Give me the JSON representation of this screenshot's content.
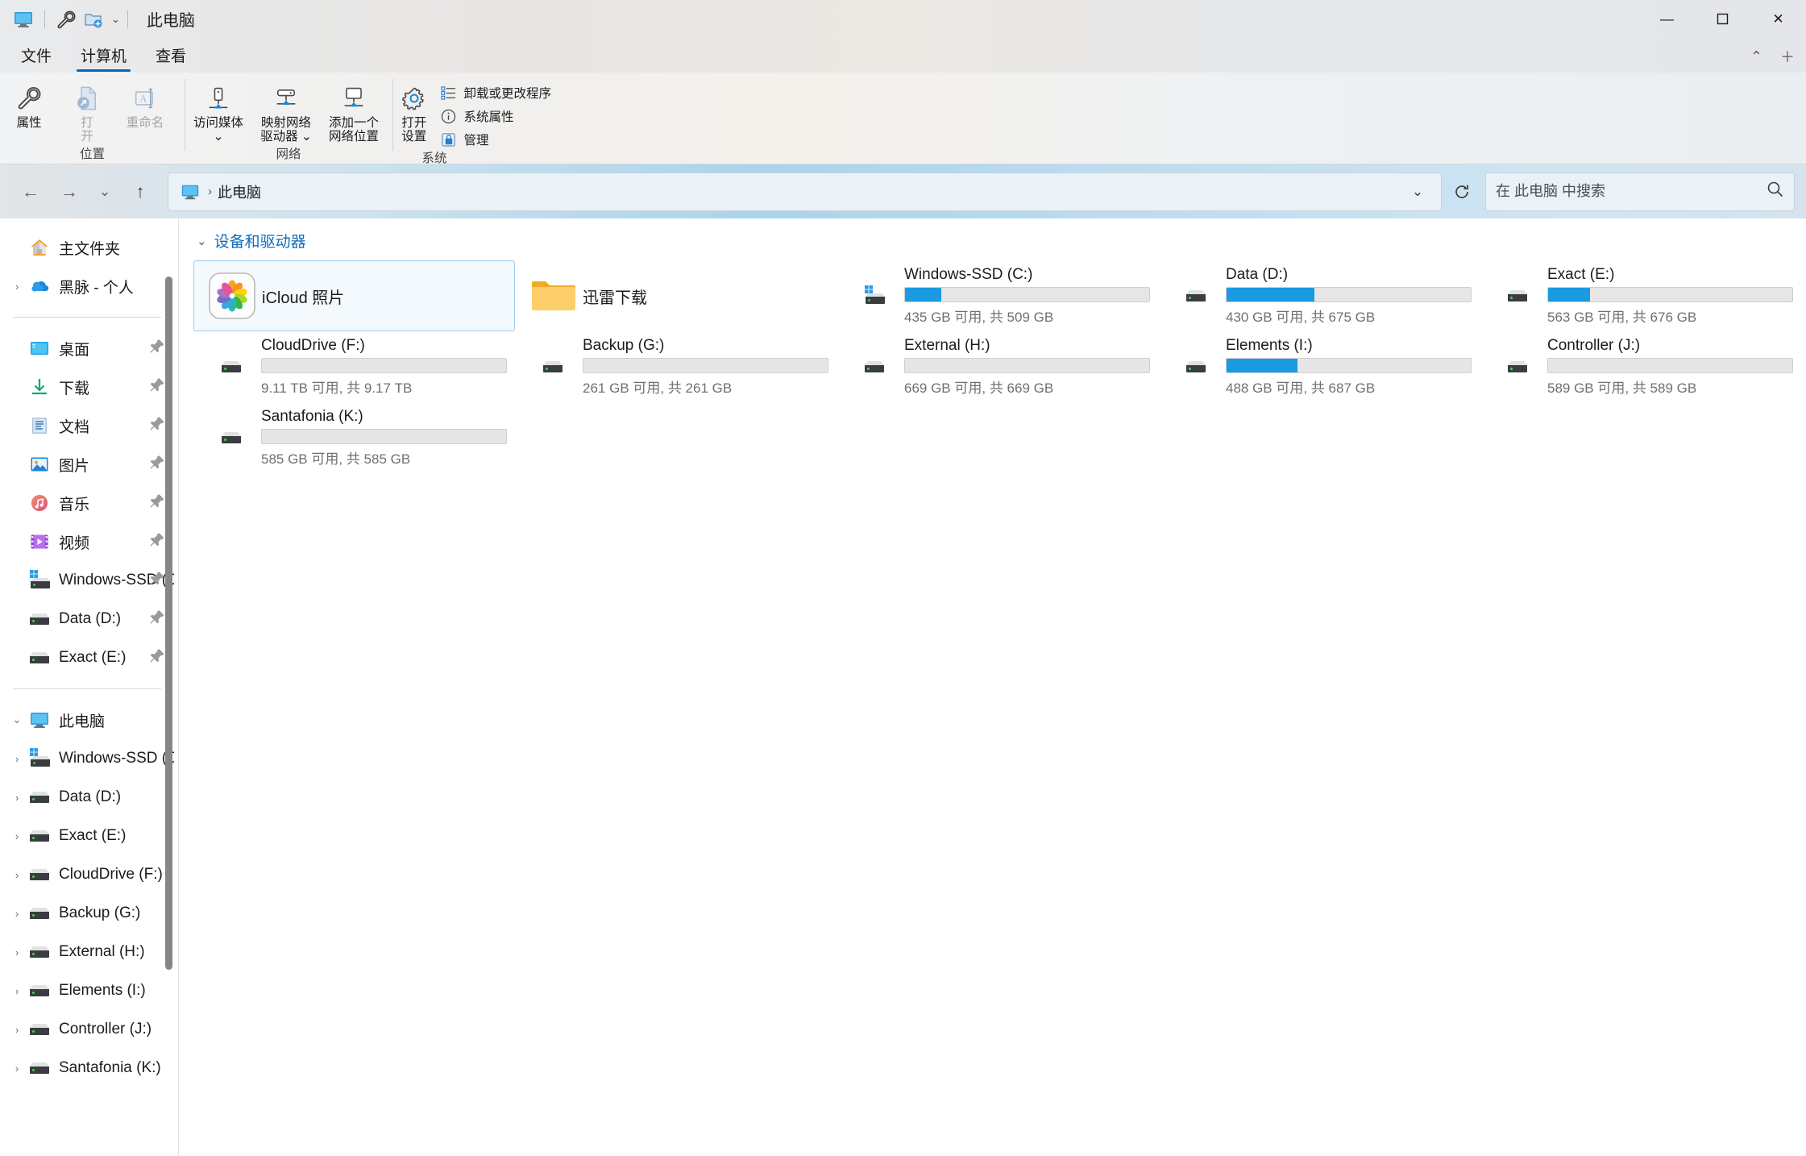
{
  "titlebar": {
    "title": "此电脑",
    "icons": [
      "monitor-icon",
      "wrench-icon",
      "new-folder-icon"
    ],
    "chevron": "⌄",
    "minimize": "—",
    "maximize": "▢",
    "close": "✕"
  },
  "tabs": {
    "items": [
      {
        "label": "文件",
        "active": false
      },
      {
        "label": "计算机",
        "active": true
      },
      {
        "label": "查看",
        "active": false
      }
    ],
    "collapse": "⌃",
    "help": "＋"
  },
  "ribbon": {
    "groups": [
      {
        "label": "位置",
        "buttons": [
          {
            "label": "属性",
            "icon": "wrench-icon",
            "disabled": false
          },
          {
            "label": "打\n开",
            "icon": "open-icon",
            "disabled": true
          },
          {
            "label": "重命名",
            "icon": "rename-icon",
            "disabled": true
          }
        ]
      },
      {
        "label": "网络",
        "buttons": [
          {
            "label": "访问媒体\n⌄",
            "icon": "media-server-icon",
            "disabled": false
          },
          {
            "label": "映射网络\n驱动器 ⌄",
            "icon": "map-drive-icon",
            "disabled": false
          },
          {
            "label": "添加一个\n网络位置",
            "icon": "add-network-icon",
            "disabled": false
          }
        ]
      },
      {
        "label": "系统",
        "buttons": [
          {
            "label": "打开\n设置",
            "icon": "gear-icon",
            "disabled": false
          }
        ],
        "small_items": [
          {
            "label": "卸载或更改程序",
            "icon": "uninstall-icon"
          },
          {
            "label": "系统属性",
            "icon": "info-icon"
          },
          {
            "label": "管理",
            "icon": "manage-icon"
          }
        ]
      }
    ]
  },
  "addressbar": {
    "back": "←",
    "forward": "→",
    "recent": "⌄",
    "up": "↑",
    "breadcrumb_icon": "this-pc-icon",
    "breadcrumb_sep": "›",
    "breadcrumb_text": "此电脑",
    "history_chevron": "⌄",
    "refresh": "⟳"
  },
  "search": {
    "placeholder": "在 此电脑 中搜索",
    "value": "",
    "icon": "search-icon"
  },
  "sidebar": {
    "items": [
      {
        "label": "主文件夹",
        "icon": "home-icon",
        "chevron": "",
        "pin": false
      },
      {
        "label": "黑脉 - 个人",
        "icon": "onedrive-icon",
        "chevron": "›",
        "pin": false
      },
      {
        "type": "separator"
      },
      {
        "label": "桌面",
        "icon": "desktop-icon",
        "chevron": "",
        "pin": true
      },
      {
        "label": "下载",
        "icon": "downloads-icon",
        "chevron": "",
        "pin": true
      },
      {
        "label": "文档",
        "icon": "documents-icon",
        "chevron": "",
        "pin": true
      },
      {
        "label": "图片",
        "icon": "pictures-icon",
        "chevron": "",
        "pin": true
      },
      {
        "label": "音乐",
        "icon": "music-icon",
        "chevron": "",
        "pin": true
      },
      {
        "label": "视频",
        "icon": "videos-icon",
        "chevron": "",
        "pin": true
      },
      {
        "label": "Windows-SSD (C:)",
        "icon": "windows-drive-icon",
        "chevron": "",
        "pin": true
      },
      {
        "label": "Data (D:)",
        "icon": "drive-icon",
        "chevron": "",
        "pin": true
      },
      {
        "label": "Exact (E:)",
        "icon": "drive-icon",
        "chevron": "",
        "pin": true
      },
      {
        "type": "separator"
      },
      {
        "label": "此电脑",
        "icon": "this-pc-icon",
        "chevron": "⌄",
        "pin": false
      },
      {
        "label": "Windows-SSD (C:)",
        "icon": "windows-drive-icon",
        "chevron": "›",
        "pin": false,
        "indent": true
      },
      {
        "label": "Data (D:)",
        "icon": "drive-icon",
        "chevron": "›",
        "pin": false,
        "indent": true
      },
      {
        "label": "Exact (E:)",
        "icon": "drive-icon",
        "chevron": "›",
        "pin": false,
        "indent": true
      },
      {
        "label": "CloudDrive (F:)",
        "icon": "drive-icon",
        "chevron": "›",
        "pin": false,
        "indent": true
      },
      {
        "label": "Backup (G:)",
        "icon": "drive-icon",
        "chevron": "›",
        "pin": false,
        "indent": true
      },
      {
        "label": "External (H:)",
        "icon": "drive-icon",
        "chevron": "›",
        "pin": false,
        "indent": true
      },
      {
        "label": "Elements (I:)",
        "icon": "drive-icon",
        "chevron": "›",
        "pin": false,
        "indent": true
      },
      {
        "label": "Controller (J:)",
        "icon": "drive-icon",
        "chevron": "›",
        "pin": false,
        "indent": true
      },
      {
        "label": "Santafonia (K:)",
        "icon": "drive-icon",
        "chevron": "›",
        "pin": false,
        "indent": true
      }
    ]
  },
  "content": {
    "group_chevron": "⌄",
    "group_title": "设备和驱动器",
    "tiles": [
      {
        "name": "iCloud 照片",
        "icon": "icloud-photos-icon",
        "type": "folder",
        "selected": true
      },
      {
        "name": "迅雷下载",
        "icon": "folder-icon",
        "type": "folder",
        "selected": false
      },
      {
        "name": "Windows-SSD (C:)",
        "icon": "windows-drive-icon",
        "type": "drive",
        "free": "435 GB",
        "total": "509 GB",
        "sub": "435 GB 可用, 共 509 GB",
        "used_percent": 15
      },
      {
        "name": "Data (D:)",
        "icon": "drive-icon",
        "type": "drive",
        "free": "430 GB",
        "total": "675 GB",
        "sub": "430 GB 可用, 共 675 GB",
        "used_percent": 36
      },
      {
        "name": "Exact (E:)",
        "icon": "drive-icon",
        "type": "drive",
        "free": "563 GB",
        "total": "676 GB",
        "sub": "563 GB 可用, 共 676 GB",
        "used_percent": 17
      },
      {
        "name": "CloudDrive (F:)",
        "icon": "drive-icon",
        "type": "drive",
        "free": "9.11 TB",
        "total": "9.17 TB",
        "sub": "9.11 TB 可用, 共 9.17 TB",
        "used_percent": 0
      },
      {
        "name": "Backup (G:)",
        "icon": "drive-icon",
        "type": "drive",
        "free": "261 GB",
        "total": "261 GB",
        "sub": "261 GB 可用, 共 261 GB",
        "used_percent": 0
      },
      {
        "name": "External (H:)",
        "icon": "drive-icon",
        "type": "drive",
        "free": "669 GB",
        "total": "669 GB",
        "sub": "669 GB 可用, 共 669 GB",
        "used_percent": 0
      },
      {
        "name": "Elements (I:)",
        "icon": "drive-icon",
        "type": "drive",
        "free": "488 GB",
        "total": "687 GB",
        "sub": "488 GB 可用, 共 687 GB",
        "used_percent": 29
      },
      {
        "name": "Controller (J:)",
        "icon": "drive-icon",
        "type": "drive",
        "free": "589 GB",
        "total": "589 GB",
        "sub": "589 GB 可用, 共 589 GB",
        "used_percent": 0
      },
      {
        "name": "Santafonia (K:)",
        "icon": "drive-icon",
        "type": "drive",
        "free": "585 GB",
        "total": "585 GB",
        "sub": "585 GB 可用, 共 585 GB",
        "used_percent": 0
      }
    ]
  },
  "colors": {
    "accent": "#0067c0",
    "link": "#0f6cbd",
    "bar_fill": "#1a9ae0",
    "selection_bg": "#f3f9fd",
    "selection_border": "#9ecbec"
  }
}
